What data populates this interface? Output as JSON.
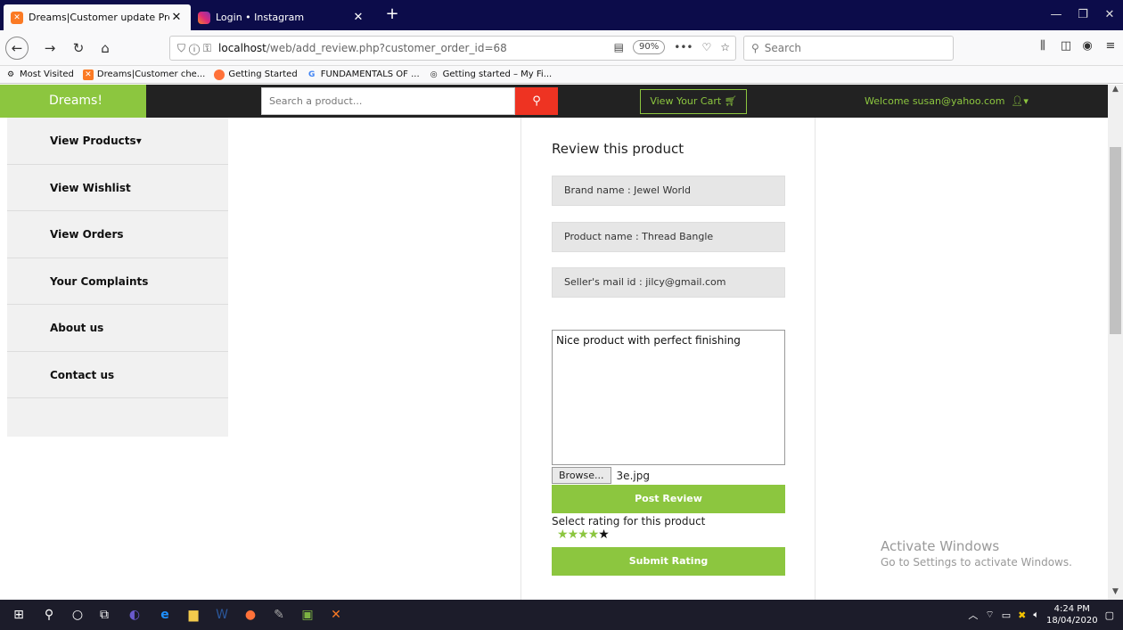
{
  "browser": {
    "tabs": [
      {
        "title": "Dreams|Customer update Profi",
        "active": true
      },
      {
        "title": "Login • Instagram",
        "active": false
      }
    ],
    "url_host": "localhost",
    "url_path": "/web/add_review.php?customer_order_id=68",
    "zoom": "90%",
    "search_placeholder": "Search",
    "bookmarks": [
      "Most Visited",
      "Dreams|Customer che...",
      "Getting Started",
      "FUNDAMENTALS OF ...",
      "Getting started – My Fi..."
    ]
  },
  "site": {
    "brand": "Dreams!",
    "search_placeholder": "Search a product...",
    "cart_label": "View Your Cart",
    "welcome": "Welcome  susan@yahoo.com"
  },
  "sidebar": {
    "items": [
      {
        "label": "View Products"
      },
      {
        "label": "View Wishlist"
      },
      {
        "label": "View Orders"
      },
      {
        "label": "Your Complaints"
      },
      {
        "label": "About us"
      },
      {
        "label": "Contact us"
      }
    ]
  },
  "review": {
    "title": "Review this product",
    "brand": "Brand name : Jewel World",
    "product": "Product name : Thread Bangle",
    "seller": "Seller's mail id : jilcy@gmail.com",
    "text": "Nice product with perfect finishing",
    "browse_label": "Browse...",
    "file_name": "3e.jpg",
    "post_label": "Post Review",
    "rating_label": "Select rating for this product",
    "rating": 4,
    "rating_max": 5,
    "submit_label": "Submit Rating"
  },
  "watermark": {
    "title": "Activate Windows",
    "subtitle": "Go to Settings to activate Windows."
  },
  "taskbar": {
    "time": "4:24 PM",
    "date": "18/04/2020"
  },
  "colors": {
    "accent_green": "#8cc63f",
    "search_red": "#ee3322",
    "header_dark": "#222222"
  }
}
